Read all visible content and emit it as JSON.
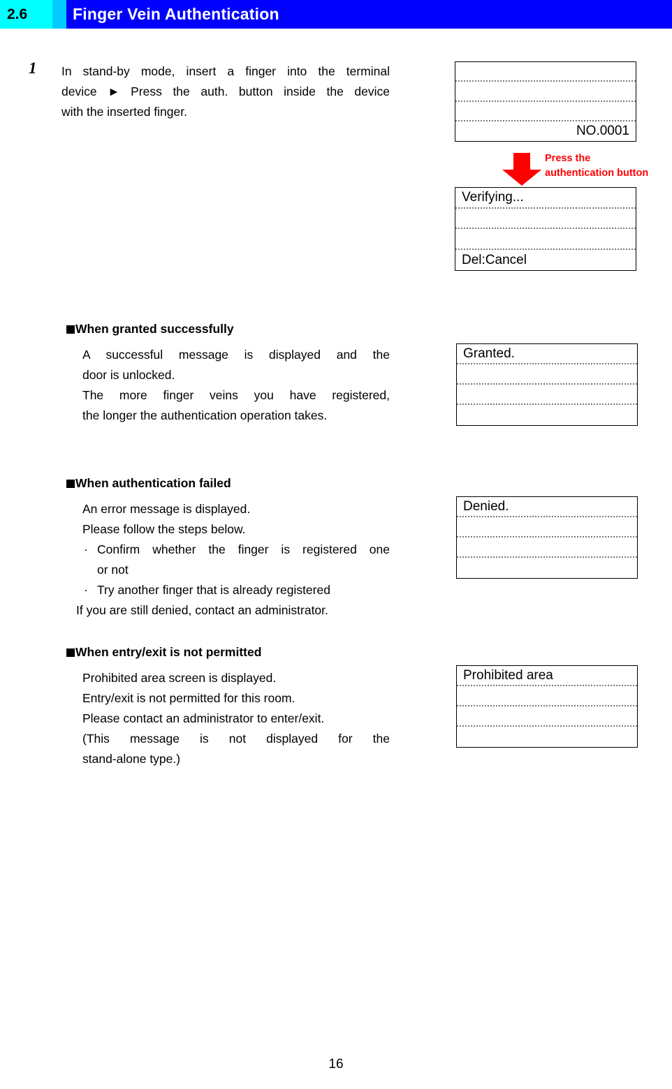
{
  "header": {
    "section_number": "2.6",
    "title": "Finger Vein Authentication",
    "accent_cyan": "#00ffff",
    "accent_cyan_light": "#00ccff",
    "accent_blue": "#0000ff"
  },
  "step": {
    "number": "1",
    "line1": "In stand-by mode, insert a finger into the terminal",
    "line2": "device ► Press the auth. button inside the device",
    "line3": "with the inserted finger."
  },
  "callout": {
    "line1": "Press the",
    "line2": "authentication button",
    "color": "#ff0000",
    "arrow_icon": "down-arrow-icon"
  },
  "panels": {
    "standby": {
      "name": "standby-screen",
      "rows": [
        "",
        "",
        "",
        "NO.0001"
      ],
      "align_last_right": true
    },
    "verifying": {
      "name": "verifying-screen",
      "rows": [
        "Verifying...",
        "",
        "",
        "Del:Cancel"
      ]
    },
    "granted": {
      "name": "granted-screen",
      "rows": [
        "Granted.",
        "",
        "",
        ""
      ]
    },
    "denied": {
      "name": "denied-screen",
      "rows": [
        "Denied.",
        "",
        "",
        ""
      ]
    },
    "prohibited": {
      "name": "prohibited-area-screen",
      "rows": [
        "Prohibited area",
        "",
        "",
        ""
      ]
    }
  },
  "sections": {
    "granted": {
      "heading": "When granted successfully",
      "line1": "A successful message is displayed and the",
      "line2": "door is unlocked.",
      "line3": "The more finger veins you have registered,",
      "line4": "the longer the authentication operation takes."
    },
    "failed": {
      "heading": "When authentication failed",
      "line1": "An error message is displayed.",
      "line2": "Please follow the steps below.",
      "bullet_mark": "·",
      "bullet1_line1": "Confirm whether the finger is registered one",
      "bullet1_line2": "or not",
      "bullet2": "Try another finger that is already registered",
      "line3": "If you are still denied, contact an administrator."
    },
    "not_permitted": {
      "heading": "When entry/exit is not permitted",
      "line1": "Prohibited area screen is displayed.",
      "line2": "Entry/exit is not permitted for this room.",
      "line3": "Please contact an administrator to enter/exit.",
      "line4": "(This message is not displayed for the",
      "line5": "stand-alone type.)"
    }
  },
  "footer": {
    "page_number": "16"
  }
}
